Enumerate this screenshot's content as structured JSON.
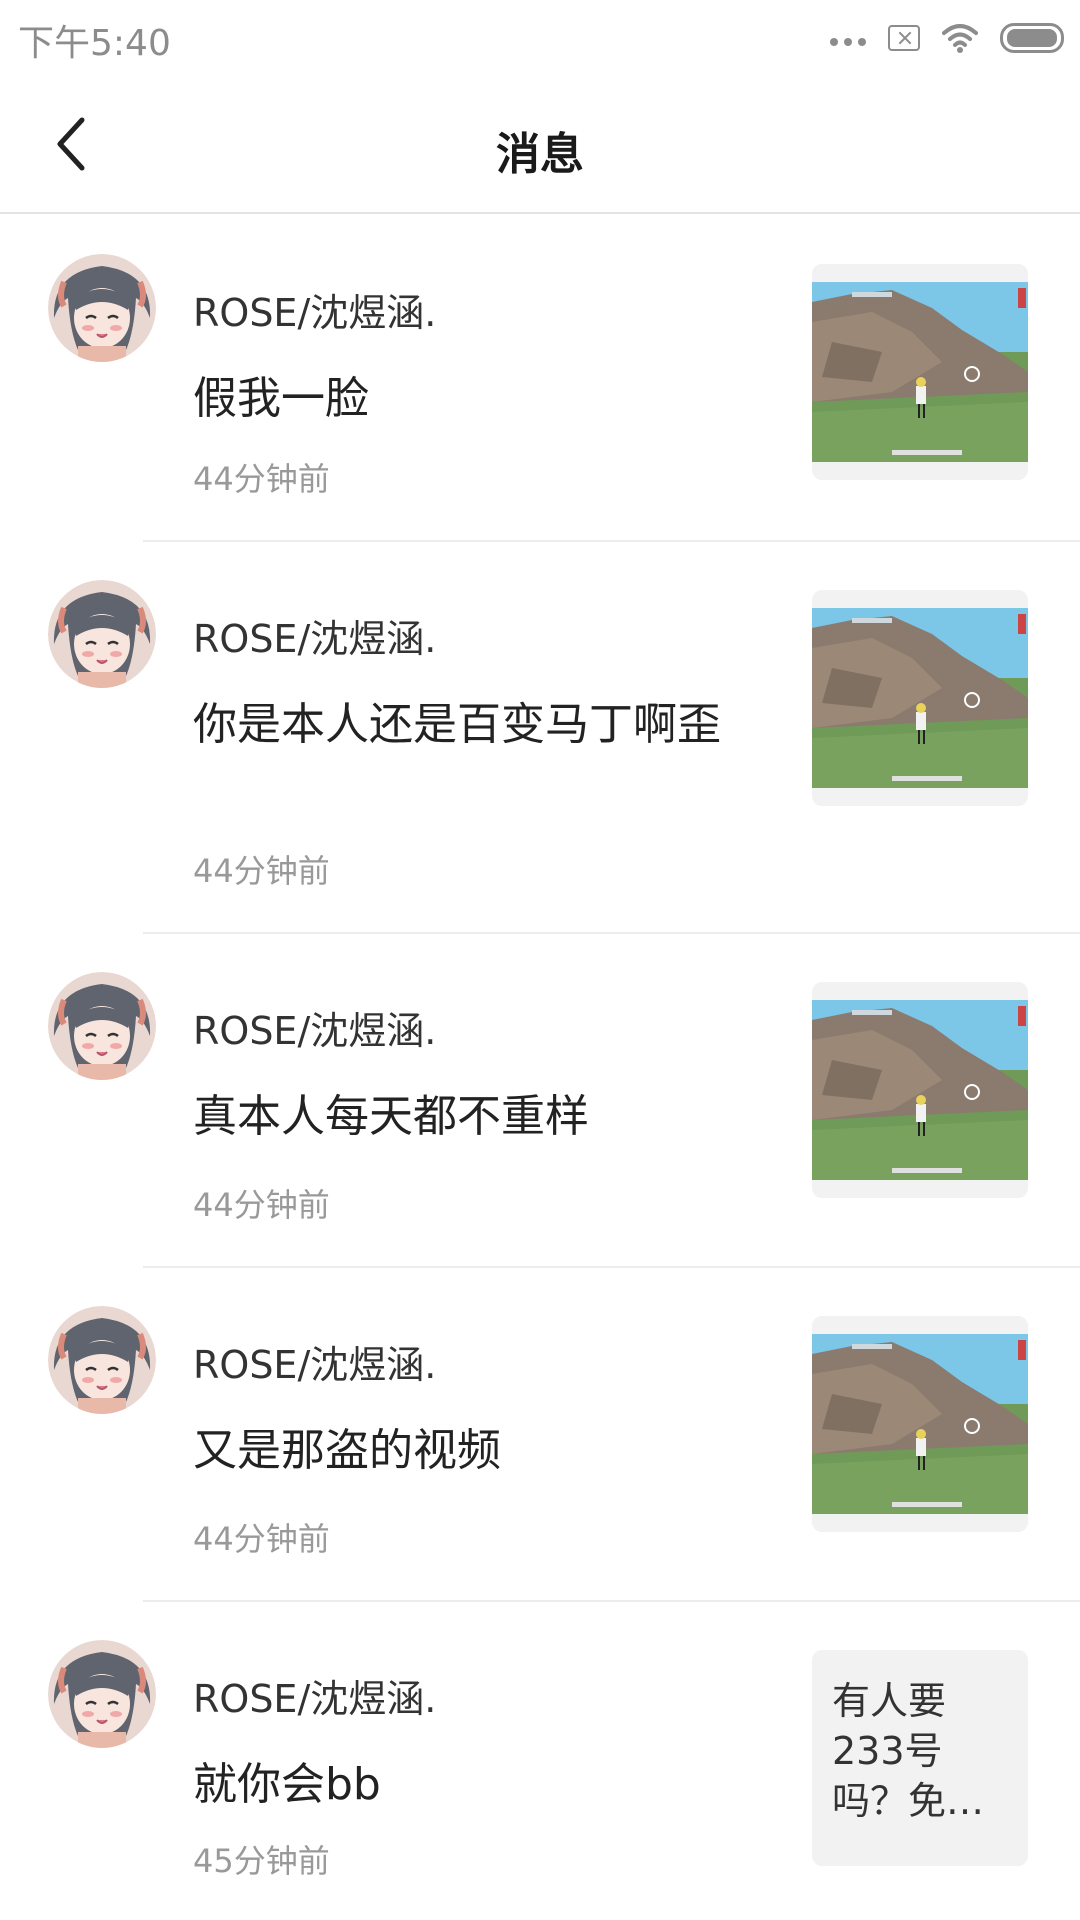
{
  "status": {
    "time": "下午5:40"
  },
  "header": {
    "title": "消息"
  },
  "messages": [
    {
      "name": "ROSE/沈煜涵.",
      "text": "假我一脸",
      "time": "44分钟前",
      "thumb_type": "image"
    },
    {
      "name": "ROSE/沈煜涵.",
      "text": "你是本人还是百变马丁啊歪",
      "time": "44分钟前",
      "thumb_type": "image"
    },
    {
      "name": "ROSE/沈煜涵.",
      "text": "真本人每天都不重样",
      "time": "44分钟前",
      "thumb_type": "image"
    },
    {
      "name": "ROSE/沈煜涵.",
      "text": "又是那盗的视频",
      "time": "44分钟前",
      "thumb_type": "image"
    },
    {
      "name": "ROSE/沈煜涵.",
      "text": "就你会bb",
      "time": "45分钟前",
      "thumb_type": "text",
      "thumb_text": "有人要233号吗？免…"
    }
  ],
  "colors": {
    "divider": "#ececec",
    "time_text": "#999999",
    "thumb_bg": "#f2f2f2"
  }
}
